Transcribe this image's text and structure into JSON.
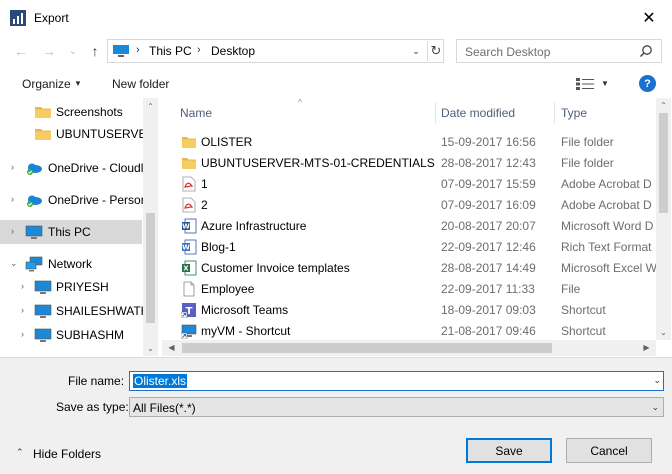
{
  "window": {
    "title": "Export",
    "close_glyph": "✕"
  },
  "address_bar": {
    "segments": [
      "This PC",
      "Desktop"
    ],
    "separator": "›",
    "dropdown_glyph": "⌄",
    "refresh_glyph": "↻"
  },
  "search": {
    "placeholder": "Search Desktop"
  },
  "nav_buttons": {
    "back": "←",
    "forward": "→",
    "recent": "⌄",
    "up": "↑"
  },
  "toolbar": {
    "organize_label": "Organize",
    "new_folder_label": "New folder",
    "dropdown_glyph": "▼",
    "help_label": "?"
  },
  "nav_tree": [
    {
      "label": "Screenshots",
      "icon": "folder-icon",
      "expander": ""
    },
    {
      "label": "UBUNTUSERVER",
      "icon": "folder-icon",
      "expander": ""
    },
    {
      "label": "OneDrive - Cloudl",
      "icon": "onedrive-icon",
      "expander": "›"
    },
    {
      "label": "OneDrive - Person",
      "icon": "onedrive-icon",
      "expander": "›"
    },
    {
      "label": "This PC",
      "icon": "computer-icon",
      "expander": "›",
      "selected": true
    },
    {
      "label": "Network",
      "icon": "network-icon",
      "expander": "⌄"
    },
    {
      "label": "PRIYESH",
      "icon": "computer-icon",
      "expander": "›"
    },
    {
      "label": "SHAILESHWATH",
      "icon": "computer-icon",
      "expander": "›"
    },
    {
      "label": "SUBHASHM",
      "icon": "computer-icon",
      "expander": "›"
    }
  ],
  "columns": {
    "name": "Name",
    "date": "Date modified",
    "type": "Type",
    "sort_glyph": "^"
  },
  "files": [
    {
      "name": "OLISTER",
      "date": "15-09-2017 16:56",
      "type": "File folder",
      "icon": "folder-icon"
    },
    {
      "name": "UBUNTUSERVER-MTS-01-CREDENTIALS",
      "date": "28-08-2017 12:43",
      "type": "File folder",
      "icon": "folder-icon"
    },
    {
      "name": "1",
      "date": "07-09-2017 15:59",
      "type": "Adobe Acrobat D",
      "icon": "pdf-icon"
    },
    {
      "name": "2",
      "date": "07-09-2017 16:09",
      "type": "Adobe Acrobat D",
      "icon": "pdf-icon"
    },
    {
      "name": "Azure Infrastructure",
      "date": "20-08-2017 20:07",
      "type": "Microsoft Word D",
      "icon": "word-doc-icon"
    },
    {
      "name": "Blog-1",
      "date": "22-09-2017 12:46",
      "type": "Rich Text Format",
      "icon": "rtf-icon"
    },
    {
      "name": "Customer Invoice templates",
      "date": "28-08-2017 14:49",
      "type": "Microsoft Excel W",
      "icon": "excel-icon"
    },
    {
      "name": "Employee",
      "date": "22-09-2017 11:33",
      "type": "File",
      "icon": "blank-file-icon"
    },
    {
      "name": "Microsoft Teams",
      "date": "18-09-2017 09:03",
      "type": "Shortcut",
      "icon": "teams-shortcut-icon"
    },
    {
      "name": "myVM - Shortcut",
      "date": "21-08-2017 09:46",
      "type": "Shortcut",
      "icon": "rdp-shortcut-icon"
    }
  ],
  "scroll_glyphs": {
    "up": "▲",
    "down": "▼",
    "left": "◀",
    "right": "▶",
    "chevron_up": "⌃",
    "chevron_down": "⌄"
  },
  "form": {
    "file_name_label": "File name:",
    "file_name_value": "Olister.xls",
    "save_as_type_label": "Save as type:",
    "save_as_type_value": "All Files(*.*)",
    "dropdown_glyph": "⌄"
  },
  "footer": {
    "hide_folders_label": "Hide Folders",
    "hide_folders_glyph": "⌃",
    "save_label": "Save",
    "cancel_label": "Cancel"
  },
  "colors": {
    "accent": "#0078d7",
    "folder": "#e8b84a",
    "selection": "#d9d9d9",
    "header_text": "#4c607a"
  }
}
